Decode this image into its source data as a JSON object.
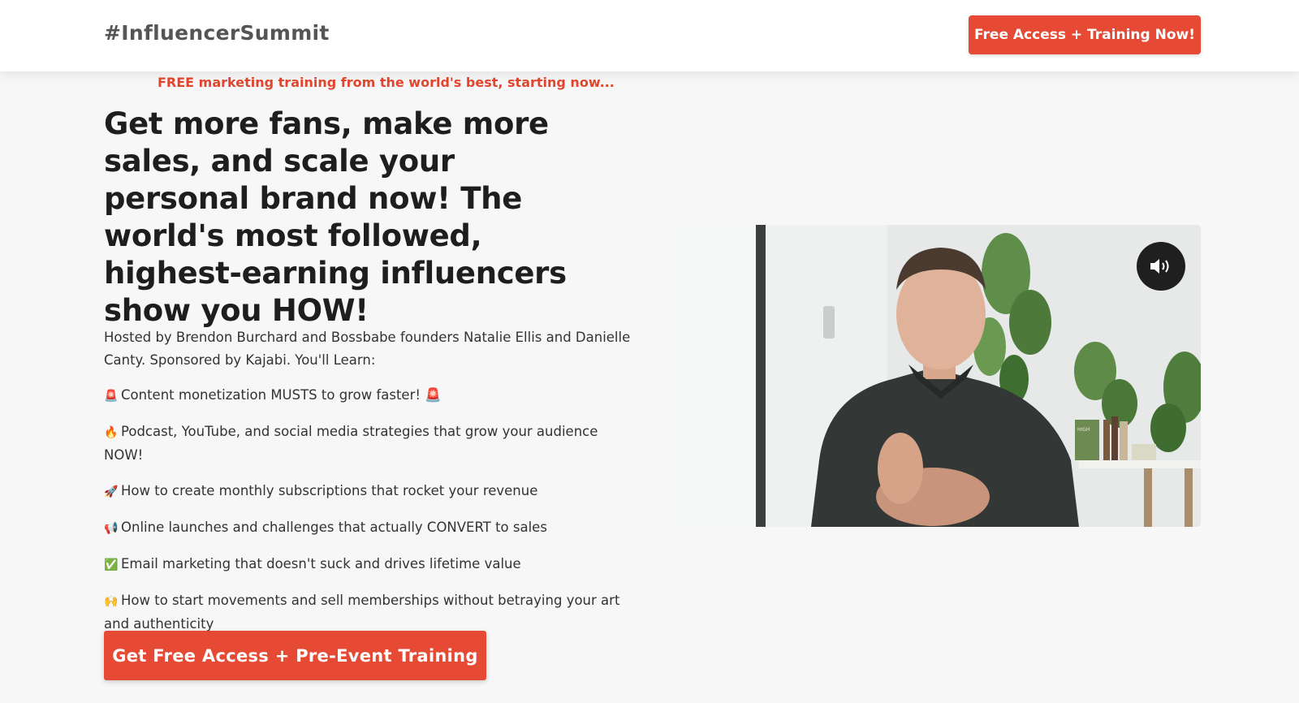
{
  "header": {
    "brand": "#InfluencerSummit",
    "cta_label": "Free Access + Training Now!"
  },
  "hero": {
    "tagline": "FREE marketing training from the world's best, starting now...",
    "headline": "Get more fans, make more sales, and scale your personal brand now! The world's most followed, highest-earning influencers show you HOW!",
    "intro": "Hosted by Brendon Burchard and Bossbabe founders Natalie Ellis and Danielle Canty. Sponsored by Kajabi. You'll Learn:",
    "bullets": [
      {
        "icon": "🚨",
        "icon_name": "siren-icon",
        "text": "Content monetization MUSTS to grow faster! 🚨"
      },
      {
        "icon": "🔥",
        "icon_name": "fire-icon",
        "text": "Podcast, YouTube, and social media strategies that grow your audience NOW!"
      },
      {
        "icon": "🚀",
        "icon_name": "rocket-icon",
        "text": "How to create monthly subscriptions that rocket your revenue"
      },
      {
        "icon": "📢",
        "icon_name": "megaphone-icon",
        "text": "Online launches and challenges that actually CONVERT to sales"
      },
      {
        "icon": "✅",
        "icon_name": "check-mark-icon",
        "text": "Email marketing that doesn't suck and drives lifetime value"
      },
      {
        "icon": "🙌",
        "icon_name": "raised-hands-icon",
        "text": "How to start movements and sell memberships without betraying your art and authenticity"
      }
    ],
    "cta_label": "Get Free Access + Pre-Event Training"
  },
  "video": {
    "book_spine_text": "HIGH PERFORMANCE HABITS",
    "mute_icon": "volume-icon"
  },
  "colors": {
    "accent": "#e64a35",
    "tagline": "#e2462f",
    "page_bg": "#f7f7f7"
  }
}
